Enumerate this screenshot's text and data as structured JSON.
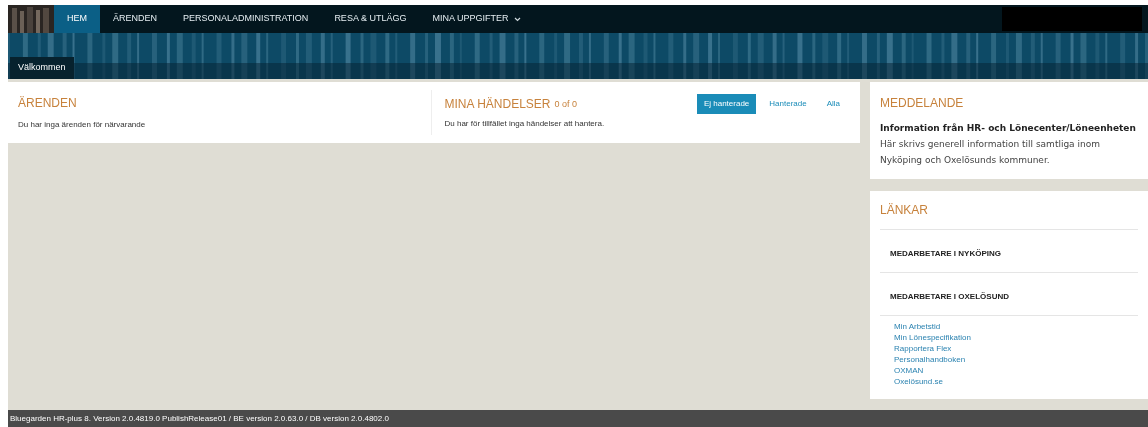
{
  "nav": {
    "items": [
      {
        "label": "HEM",
        "selected": true
      },
      {
        "label": "ÄRENDEN",
        "selected": false
      },
      {
        "label": "PERSONALADMINISTRATION",
        "selected": false
      },
      {
        "label": "RESA & UTLÄGG",
        "selected": false
      },
      {
        "label": "MINA UPPGIFTER",
        "selected": false,
        "dropdown": true
      }
    ]
  },
  "banner": {
    "tab": "Välkommen"
  },
  "arenden": {
    "title": "ÄRENDEN",
    "text": "Du har inga ärenden för närvarande"
  },
  "handelser": {
    "title": "MINA HÄNDELSER",
    "count": "0 of 0",
    "text": "Du har för tillfället inga händelser att hantera.",
    "filters": [
      {
        "label": "Ej hanterade",
        "selected": true
      },
      {
        "label": "Hanterade",
        "selected": false
      },
      {
        "label": "Alla",
        "selected": false
      }
    ]
  },
  "meddelande": {
    "title": "MEDDELANDE",
    "heading": "Information från HR- och Lönecenter/Löneenheten",
    "body": "Här skrivs generell information till samtliga inom Nyköping och Oxelösunds kommuner."
  },
  "lankar": {
    "title": "LÄNKAR",
    "groups": [
      "MEDARBETARE I NYKÖPING",
      "MEDARBETARE I OXELÖSUND"
    ],
    "links": [
      "Min Arbetstid",
      "Min Lönespecifikation",
      "Rapportera Flex",
      "Personalhandboken",
      "OXMAN",
      "Oxelösund.se"
    ]
  },
  "status_bar": "Bluegarden HR-plus 8. Version 2.0.4819.0 PublishRelease01 / BE version 2.0.63.0 / DB version 2.0.4802.0"
}
